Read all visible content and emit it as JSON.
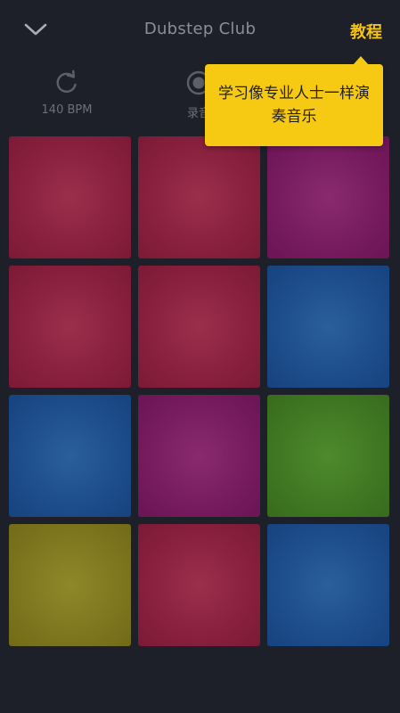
{
  "header": {
    "title": "Dubstep Club",
    "tutorial_label": "教程",
    "back_icon": "chevron-down-icon"
  },
  "controls": {
    "bpm_label": "140 BPM",
    "bpm_icon": "refresh-icon",
    "record_label": "录音",
    "record_icon": "record-icon"
  },
  "tooltip": {
    "text": "学习像专业人士一样演奏音乐"
  },
  "pads": [
    {
      "color": "red"
    },
    {
      "color": "red"
    },
    {
      "color": "purple"
    },
    {
      "color": "red"
    },
    {
      "color": "red"
    },
    {
      "color": "blue"
    },
    {
      "color": "blue"
    },
    {
      "color": "purple"
    },
    {
      "color": "green"
    },
    {
      "color": "olive"
    },
    {
      "color": "red"
    },
    {
      "color": "blue"
    }
  ],
  "colors": {
    "accent": "#f5c312",
    "background": "#1e2029",
    "red": "#851e3c",
    "purple": "#73195c",
    "blue": "#1b4a87",
    "green": "#3d7420",
    "olive": "#7a731d"
  }
}
